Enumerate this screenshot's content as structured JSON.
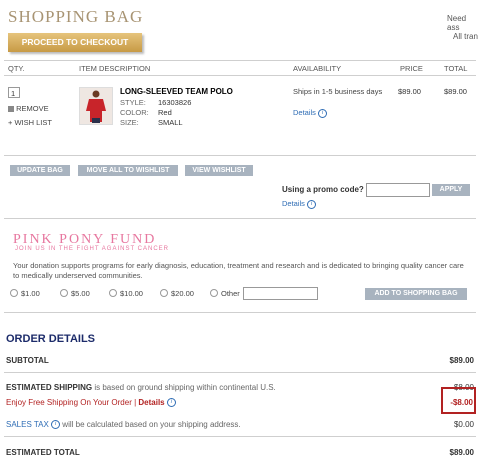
{
  "page": {
    "title": "SHOPPING BAG",
    "need_assist": "Need ass",
    "all_trans": "All tran"
  },
  "checkout": {
    "label": "PROCEED TO CHECKOUT"
  },
  "table": {
    "headers": {
      "qty": "QTY.",
      "description": "ITEM DESCRIPTION",
      "availability": "AVAILABILITY",
      "price": "PRICE",
      "total": "TOTAL"
    }
  },
  "item": {
    "qty": "1",
    "remove_label": "REMOVE",
    "wishlist_label": "+ WISH LIST",
    "name": "LONG-SLEEVED TEAM POLO",
    "style_label": "STYLE:",
    "style_value": "16303826",
    "color_label": "COLOR:",
    "color_value": "Red",
    "size_label": "SIZE:",
    "size_value": "SMALL",
    "availability": "Ships in 1-5 business days",
    "details_label": "Details",
    "price": "$89.00",
    "total": "$89.00"
  },
  "actions": {
    "update_bag": "UPDATE BAG",
    "move_all": "MOVE ALL TO WISHLIST",
    "view_wishlist": "VIEW WISHLIST"
  },
  "promo": {
    "label": "Using a promo code?",
    "apply": "APPLY",
    "details": "Details",
    "value": ""
  },
  "ppf": {
    "title": "PINK PONY FUND",
    "subtitle": "JOIN US IN THE FIGHT AGAINST CANCER",
    "description": "Your donation supports programs for early diagnosis, education, treatment and research and is dedicated to bringing quality cancer care to medically underserved communities.",
    "amounts": [
      "$1.00",
      "$5.00",
      "$10.00",
      "$20.00",
      "Other"
    ],
    "other_value": "",
    "add_button": "ADD TO SHOPPING BAG"
  },
  "order": {
    "title": "ORDER DETAILS",
    "subtotal_label": "SUBTOTAL",
    "subtotal_value": "$89.00",
    "shipping_label": "ESTIMATED SHIPPING",
    "shipping_note": " is based on ground shipping within continental U.S.",
    "shipping_value": "$8.00",
    "free_ship_text": "Enjoy Free Shipping On Your Order | ",
    "free_ship_details": "Details",
    "free_ship_value": "-$8.00",
    "tax_label": "SALES TAX",
    "tax_note": " will be calculated based on your shipping address.",
    "tax_value": "$0.00",
    "total_label": "ESTIMATED TOTAL",
    "total_value": "$89.00"
  },
  "colors": {
    "accent_gold": "#c79a45",
    "title_gold": "#a89473",
    "pink": "#e7779f",
    "navy": "#1c2b6a",
    "link": "#2f6db5",
    "red": "#b22222"
  }
}
